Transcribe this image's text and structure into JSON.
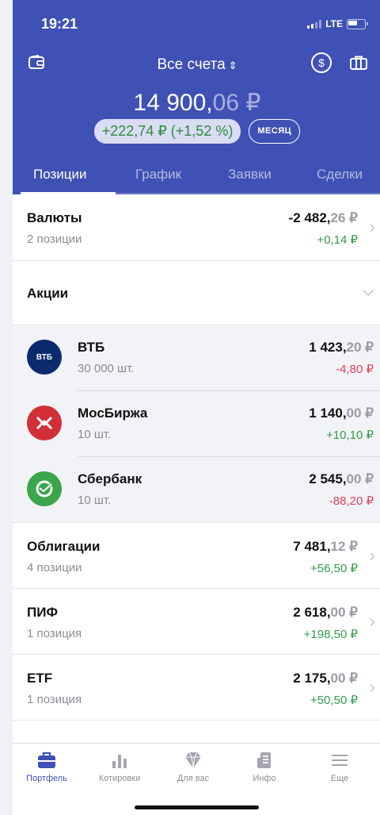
{
  "status": {
    "time": "19:21",
    "network": "LTE"
  },
  "header": {
    "account_title": "Все счета",
    "balance_int": "14 900,",
    "balance_frac": "06 ₽",
    "change": "+222,74 ₽ (+1,52 %)",
    "period": "МЕСЯЦ",
    "tabs": [
      "Позиции",
      "График",
      "Заявки",
      "Сделки"
    ],
    "active_tab": "Позиции"
  },
  "groups": {
    "currencies": {
      "name": "Валюты",
      "sub": "2 позиции",
      "value_int": "-2 482,",
      "value_frac": "26 ₽",
      "change": "+0,14 ₽"
    },
    "shares": {
      "name": "Акции"
    },
    "bonds": {
      "name": "Облигации",
      "sub": "4 позиции",
      "value_int": "7 481,",
      "value_frac": "12 ₽",
      "change": "+56,50 ₽"
    },
    "funds": {
      "name": "ПИФ",
      "sub": "1 позиция",
      "value_int": "2 618,",
      "value_frac": "00 ₽",
      "change": "+198,50 ₽"
    },
    "etf": {
      "name": "ETF",
      "sub": "1 позиция",
      "value_int": "2 175,",
      "value_frac": "00 ₽",
      "change": "+50,50 ₽"
    }
  },
  "stocks": [
    {
      "name": "ВТБ",
      "logo_text": "ВТБ",
      "qty": "30 000 шт.",
      "value_int": "1 423,",
      "value_frac": "20 ₽",
      "change": "-4,80 ₽",
      "change_color": "#e0405a",
      "logo_color": "#0b2a6e"
    },
    {
      "name": "МосБиржа",
      "qty": "10 шт.",
      "value_int": "1 140,",
      "value_frac": "00 ₽",
      "change": "+10,10 ₽",
      "change_color": "#2e9e48",
      "logo_color": "#d32f36"
    },
    {
      "name": "Сбербанк",
      "qty": "10 шт.",
      "value_int": "2 545,",
      "value_frac": "00 ₽",
      "change": "-88,20 ₽",
      "change_color": "#e0405a",
      "logo_color": "#3aa54a"
    }
  ],
  "bottom_nav": [
    {
      "label": "Портфель",
      "icon": "briefcase-icon"
    },
    {
      "label": "Котировки",
      "icon": "bar-chart-icon"
    },
    {
      "label": "Для вас",
      "icon": "diamond-icon"
    },
    {
      "label": "Инфо",
      "icon": "document-icon"
    },
    {
      "label": "Еще",
      "icon": "menu-icon"
    }
  ],
  "colors": {
    "brand": "#3f51b5",
    "positive": "#2e9e48",
    "negative": "#e0405a"
  }
}
